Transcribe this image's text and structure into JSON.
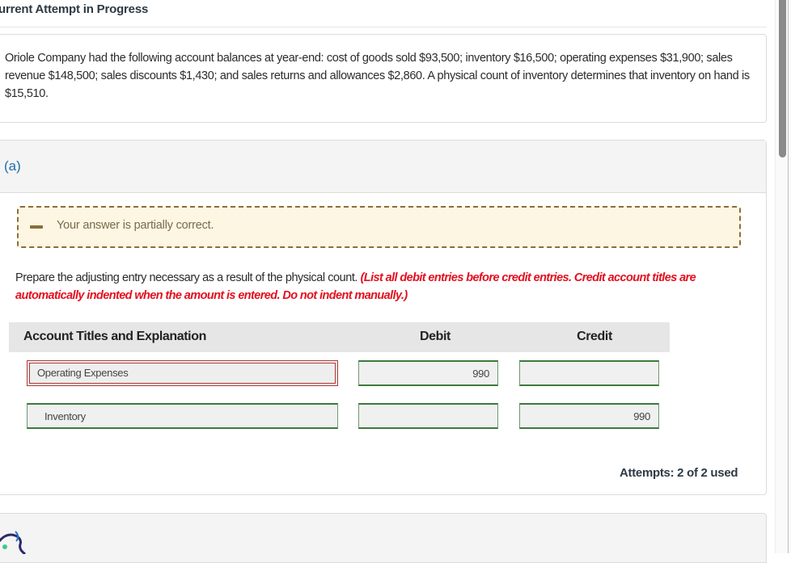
{
  "page": {
    "title": "urrent Attempt in Progress"
  },
  "question": {
    "text": "Oriole Company had the following account balances at year-end: cost of goods sold $93,500; inventory $16,500; operating expenses $31,900; sales revenue $148,500; sales discounts $1,430; and sales returns and allowances $2,860. A physical count of inventory determines that inventory on hand is $15,510."
  },
  "part": {
    "label": "(a)",
    "feedback": {
      "icon": "minus-icon",
      "text": "Your answer is partially correct.",
      "status": "partially-correct"
    },
    "instructions": {
      "main": "Prepare the adjusting entry necessary as a result of the physical count. ",
      "emphasis": "(List all debit entries before credit entries. Credit account titles are automatically indented when the amount is entered. Do not indent manually.)"
    },
    "table": {
      "headers": {
        "account": "Account Titles and Explanation",
        "debit": "Debit",
        "credit": "Credit"
      },
      "rows": [
        {
          "account": "Operating Expenses",
          "debit": "990",
          "credit": "",
          "account_status": "incorrect"
        },
        {
          "account": "Inventory",
          "debit": "",
          "credit": "990",
          "account_status": "correct"
        }
      ]
    },
    "attempts": "Attempts: 2 of 2 used"
  },
  "colors": {
    "part_label": "#1f6fa8",
    "feedback_border": "#8c6e3a",
    "feedback_bg": "#fdf6e3",
    "instruction_red": "#e3101f",
    "correct_border": "#3c7a3c",
    "incorrect_border": "#b03a3a"
  }
}
